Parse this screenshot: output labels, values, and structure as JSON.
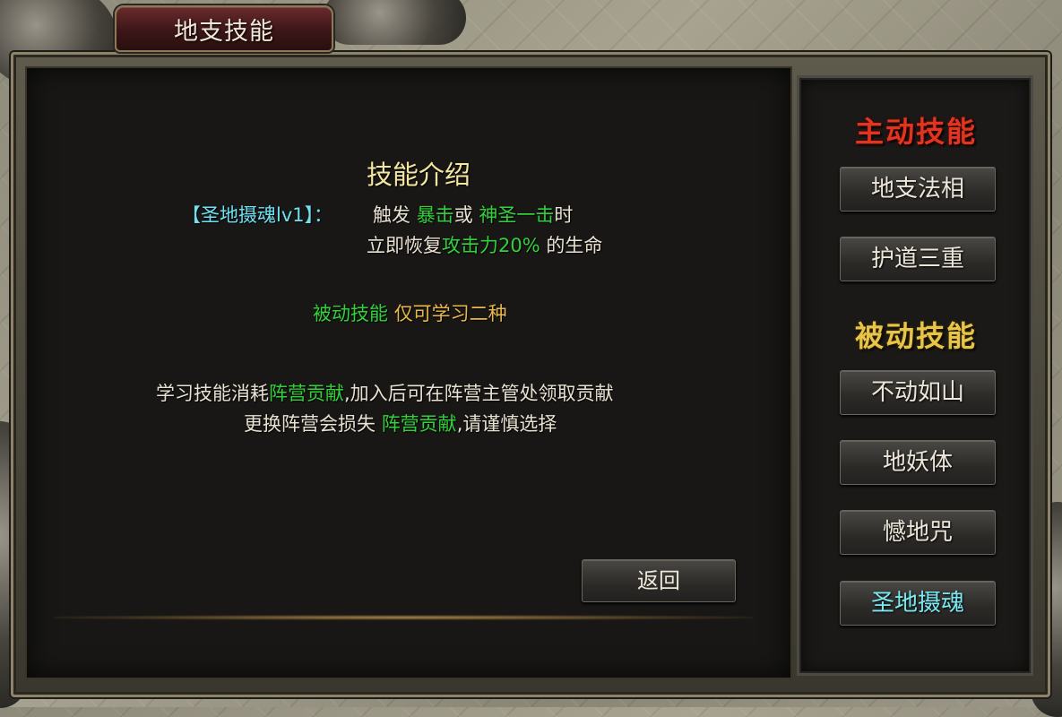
{
  "window": {
    "title": "地支技能"
  },
  "intro": {
    "heading": "技能介绍",
    "skill_name": "【圣地摄魂lv1】：",
    "line1": {
      "a": "触发",
      "b": "暴击",
      "c": "或",
      "d": "神圣一击",
      "e": "时"
    },
    "line2": {
      "a": "立即恢复",
      "b": "攻击力20%",
      "c": "的生命"
    },
    "passive_note": {
      "a": "被动技能",
      "b": "仅可学习二种"
    },
    "cost_line1": {
      "a": "学习技能消耗",
      "b": "阵营贡献",
      "c": ",加入后可在阵营主管处领取贡献"
    },
    "cost_line2": {
      "a": "更换阵营会损失",
      "b": "阵营贡献",
      "c": ",请谨慎选择"
    }
  },
  "buttons": {
    "back": "返回"
  },
  "sidebar": {
    "active_title": "主动技能",
    "active_skills": [
      "地支法相",
      "护道三重"
    ],
    "passive_title": "被动技能",
    "passive_skills": [
      "不动如山",
      "地妖体",
      "憾地咒",
      "圣地摄魂"
    ],
    "selected": "圣地摄魂"
  },
  "colors": {
    "highlight_green": "#34d03c",
    "skill_name_cyan": "#6fe0f0",
    "active_title_red": "#e2341e",
    "passive_title_gold": "#e8c548"
  }
}
